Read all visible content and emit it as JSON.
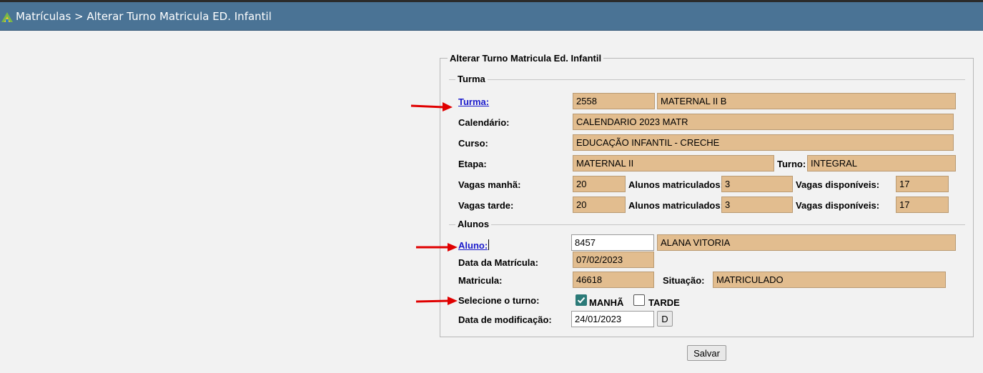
{
  "header": {
    "breadcrumb": "Matrículas > Alterar Turno Matricula ED. Infantil"
  },
  "form": {
    "legend": "Alterar Turno Matricula Ed. Infantil",
    "turma_section": {
      "legend": "Turma",
      "turma_link": "Turma:",
      "turma_code": "2558",
      "turma_name": "MATERNAL II B",
      "calendario_label": "Calendário:",
      "calendario_value": "CALENDARIO 2023 MATR",
      "curso_label": "Curso:",
      "curso_value": "EDUCAÇÃO  INFANTIL - CRECHE",
      "etapa_label": "Etapa:",
      "etapa_value": "MATERNAL II",
      "turno_label": "Turno:",
      "turno_value": "INTEGRAL",
      "vagas_manha_label": "Vagas manhã:",
      "vagas_manha_value": "20",
      "alunos_matriculados_label": "Alunos matriculados:",
      "alunos_matriculados_manha": "3",
      "vagas_disponiveis_label": "Vagas disponíveis:",
      "vagas_disponiveis_manha": "17",
      "vagas_tarde_label": "Vagas tarde:",
      "vagas_tarde_value": "20",
      "alunos_matriculados_tarde": "3",
      "vagas_disponiveis_tarde": "17"
    },
    "alunos_section": {
      "legend": "Alunos",
      "aluno_link": "Aluno:",
      "aluno_code": "8457",
      "aluno_name": "ALANA VITORIA",
      "data_matricula_label": "Data da Matrícula:",
      "data_matricula_value": "07/02/2023",
      "matricula_label": "Matricula:",
      "matricula_value": "46618",
      "situacao_label": "Situação:",
      "situacao_value": "MATRICULADO",
      "selecione_turno_label": "Selecione o turno:",
      "manha_label": "MANHÃ",
      "manha_checked": true,
      "tarde_label": "TARDE",
      "tarde_checked": false,
      "data_modificacao_label": "Data de modificação:",
      "data_modificacao_value": "24/01/2023",
      "date_button_label": "D"
    },
    "save_button": "Salvar"
  },
  "colors": {
    "title_bar": "#4a7395",
    "readonly_field": "#e2bd8f",
    "link": "#1a1acc",
    "annotation_arrow": "#e00000",
    "checkbox_checked": "#2b7a78"
  }
}
